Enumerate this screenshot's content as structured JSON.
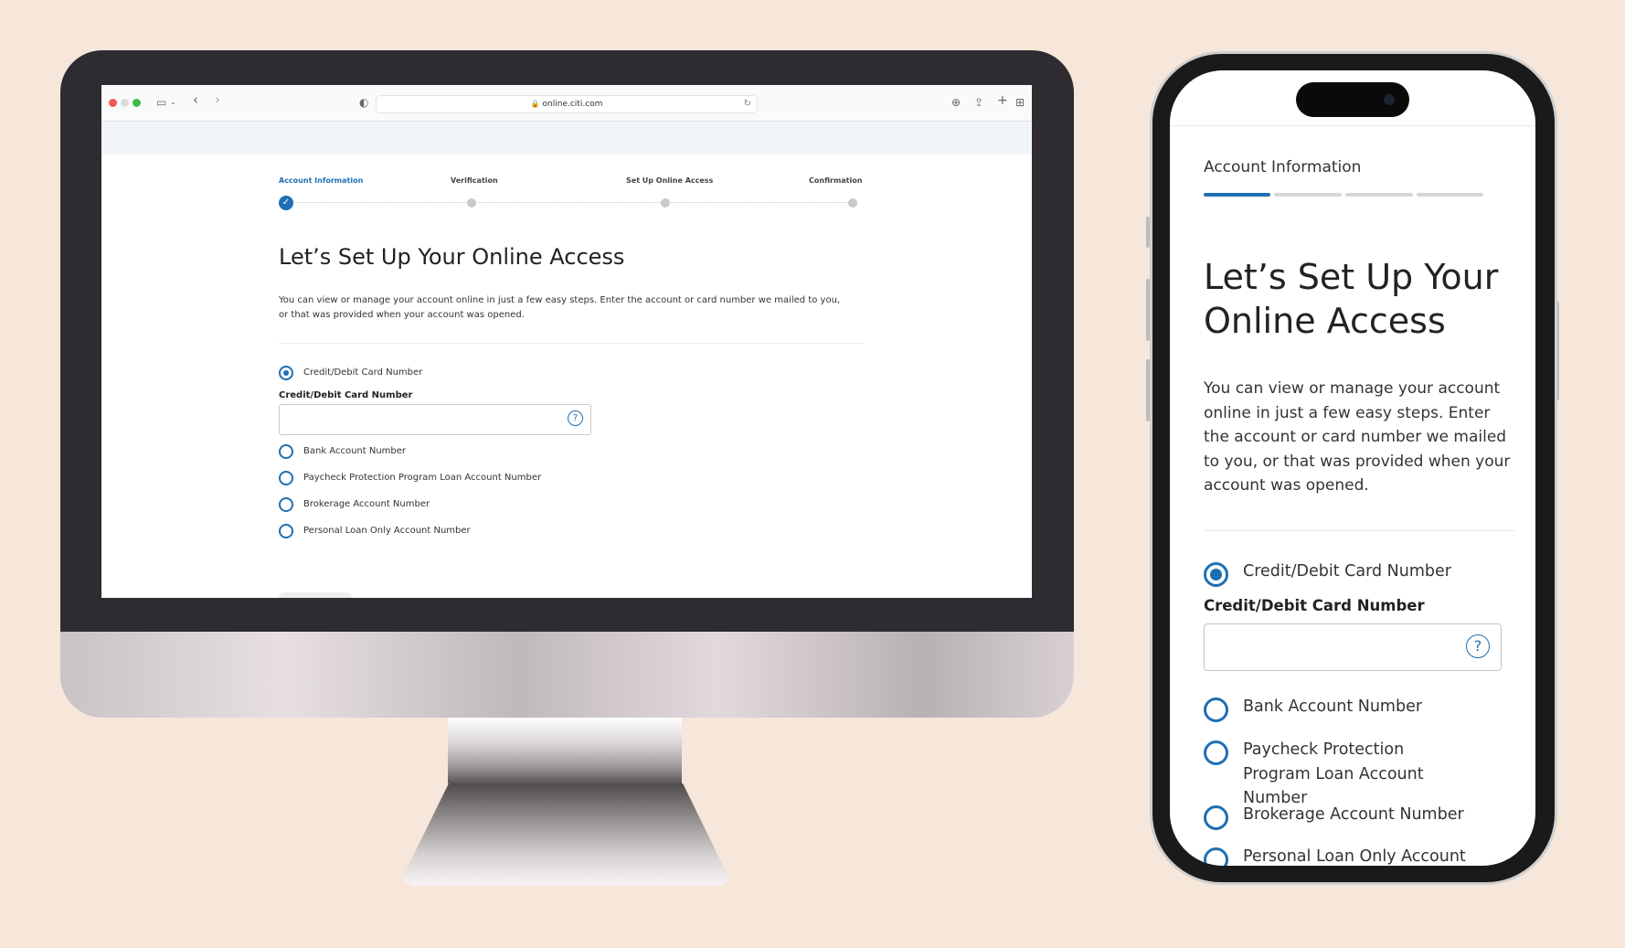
{
  "browser": {
    "url": "online.citi.com"
  },
  "steps": [
    {
      "label": "Account Information",
      "state": "done"
    },
    {
      "label": "Verification",
      "state": "pending"
    },
    {
      "label": "Set Up Online Access",
      "state": "pending"
    },
    {
      "label": "Confirmation",
      "state": "pending"
    }
  ],
  "form": {
    "title": "Let’s Set Up Your Online Access",
    "description_desktop": "You can view or manage your account online in just a few easy steps. Enter the account or card number we mailed to you, or that was provided when your account was opened.",
    "description_mobile": "You can view or manage your account online in just a few easy steps. Enter the account or card number we mailed to you, or that was provided when your account was opened.",
    "selected_option": "Credit/Debit Card Number",
    "field_label": "Credit/Debit Card Number",
    "field_value": "",
    "help_icon": "?",
    "options": [
      "Credit/Debit Card Number",
      "Bank Account Number",
      "Paycheck Protection Program Loan Account Number",
      "Brokerage Account Number",
      "Personal Loan Only Account Number"
    ]
  },
  "mobile": {
    "step_label": "Account Information",
    "progress_step": 1,
    "progress_total": 4,
    "title": "Let’s Set Up Your Online Access",
    "visible_last_option": "Personal Loan Only Account"
  },
  "colors": {
    "accent": "#1f6fb2",
    "background": "#f7e7da"
  },
  "icons": {
    "checkmark": "check-icon",
    "help": "help-icon",
    "lock": "lock-icon",
    "reload": "reload-icon"
  }
}
